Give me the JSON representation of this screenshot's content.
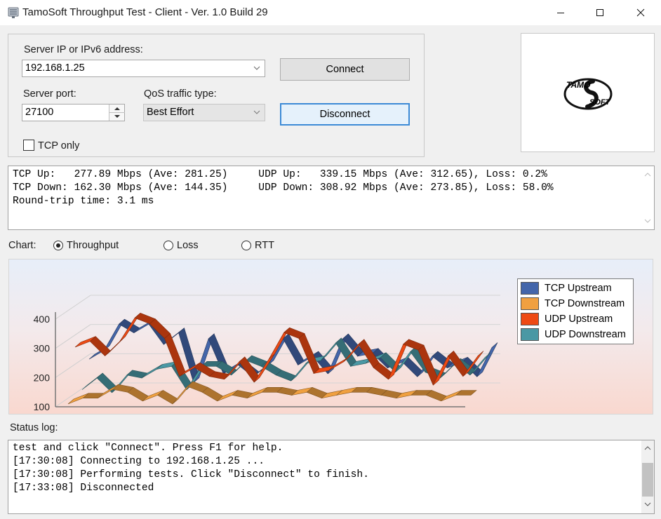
{
  "window": {
    "title": "TamoSoft Throughput Test - Client - Ver. 1.0 Build 29",
    "minimize_icon": "minimize-icon",
    "maximize_icon": "maximize-icon",
    "close_icon": "close-icon"
  },
  "connection": {
    "server_label": "Server IP or IPv6  address:",
    "server_value": "192.168.1.25",
    "port_label": "Server port:",
    "port_value": "27100",
    "qos_label": "QoS traffic type:",
    "qos_value": "Best Effort",
    "connect_label": "Connect",
    "disconnect_label": "Disconnect",
    "tcp_only_label": "TCP only",
    "tcp_only_checked": false
  },
  "logo": {
    "line1": "TAMO",
    "line2": "SOFT"
  },
  "stats": {
    "lines": [
      "TCP Up:   277.89 Mbps (Ave: 281.25)     UDP Up:   339.15 Mbps (Ave: 312.65), Loss: 0.2%",
      "TCP Down: 162.30 Mbps (Ave: 144.35)     UDP Down: 308.92 Mbps (Ave: 273.85), Loss: 58.0%",
      "Round-trip time: 3.1 ms"
    ]
  },
  "chart_selector": {
    "label": "Chart:",
    "options": [
      "Throughput",
      "Loss",
      "RTT"
    ],
    "selected": "Throughput"
  },
  "chart_data": {
    "type": "line",
    "yticks": [
      "400",
      "300",
      "200",
      "100"
    ],
    "ylim": [
      100,
      400
    ],
    "legend_position": "top-right",
    "series": [
      {
        "name": "TCP Upstream",
        "color": "#4466aa",
        "values": [
          210,
          240,
          330,
          300,
          330,
          260,
          300,
          130,
          280,
          160,
          190,
          150,
          190,
          280,
          190,
          220,
          160,
          280,
          220,
          230,
          180,
          200,
          150,
          220,
          180,
          200,
          150,
          250
        ]
      },
      {
        "name": "TCP Downstream",
        "color": "#f0a040",
        "values": [
          100,
          120,
          120,
          150,
          140,
          110,
          130,
          100,
          160,
          140,
          110,
          130,
          120,
          140,
          140,
          130,
          140,
          120,
          130,
          140,
          140,
          130,
          120,
          130,
          130,
          110,
          130,
          130
        ]
      },
      {
        "name": "UDP Upstream",
        "color": "#ee4a14",
        "values": [
          280,
          300,
          250,
          300,
          380,
          360,
          310,
          180,
          210,
          180,
          170,
          230,
          160,
          240,
          330,
          310,
          190,
          200,
          230,
          290,
          210,
          170,
          290,
          270,
          150,
          250,
          180,
          250
        ]
      },
      {
        "name": "UDP Downstream",
        "color": "#4a98a4",
        "values": [
          120,
          160,
          110,
          170,
          160,
          190,
          200,
          120,
          200,
          200,
          170,
          220,
          200,
          170,
          150,
          210,
          220,
          280,
          200,
          210,
          230,
          180,
          250,
          180,
          160,
          210,
          170,
          230
        ]
      }
    ]
  },
  "status": {
    "label": "Status log:",
    "lines": [
      "test and click \"Connect\". Press F1 for help.",
      "[17:30:08] Connecting to 192.168.1.25 ...",
      "[17:30:08] Performing tests. Click \"Disconnect\" to finish.",
      "[17:33:08] Disconnected"
    ]
  }
}
